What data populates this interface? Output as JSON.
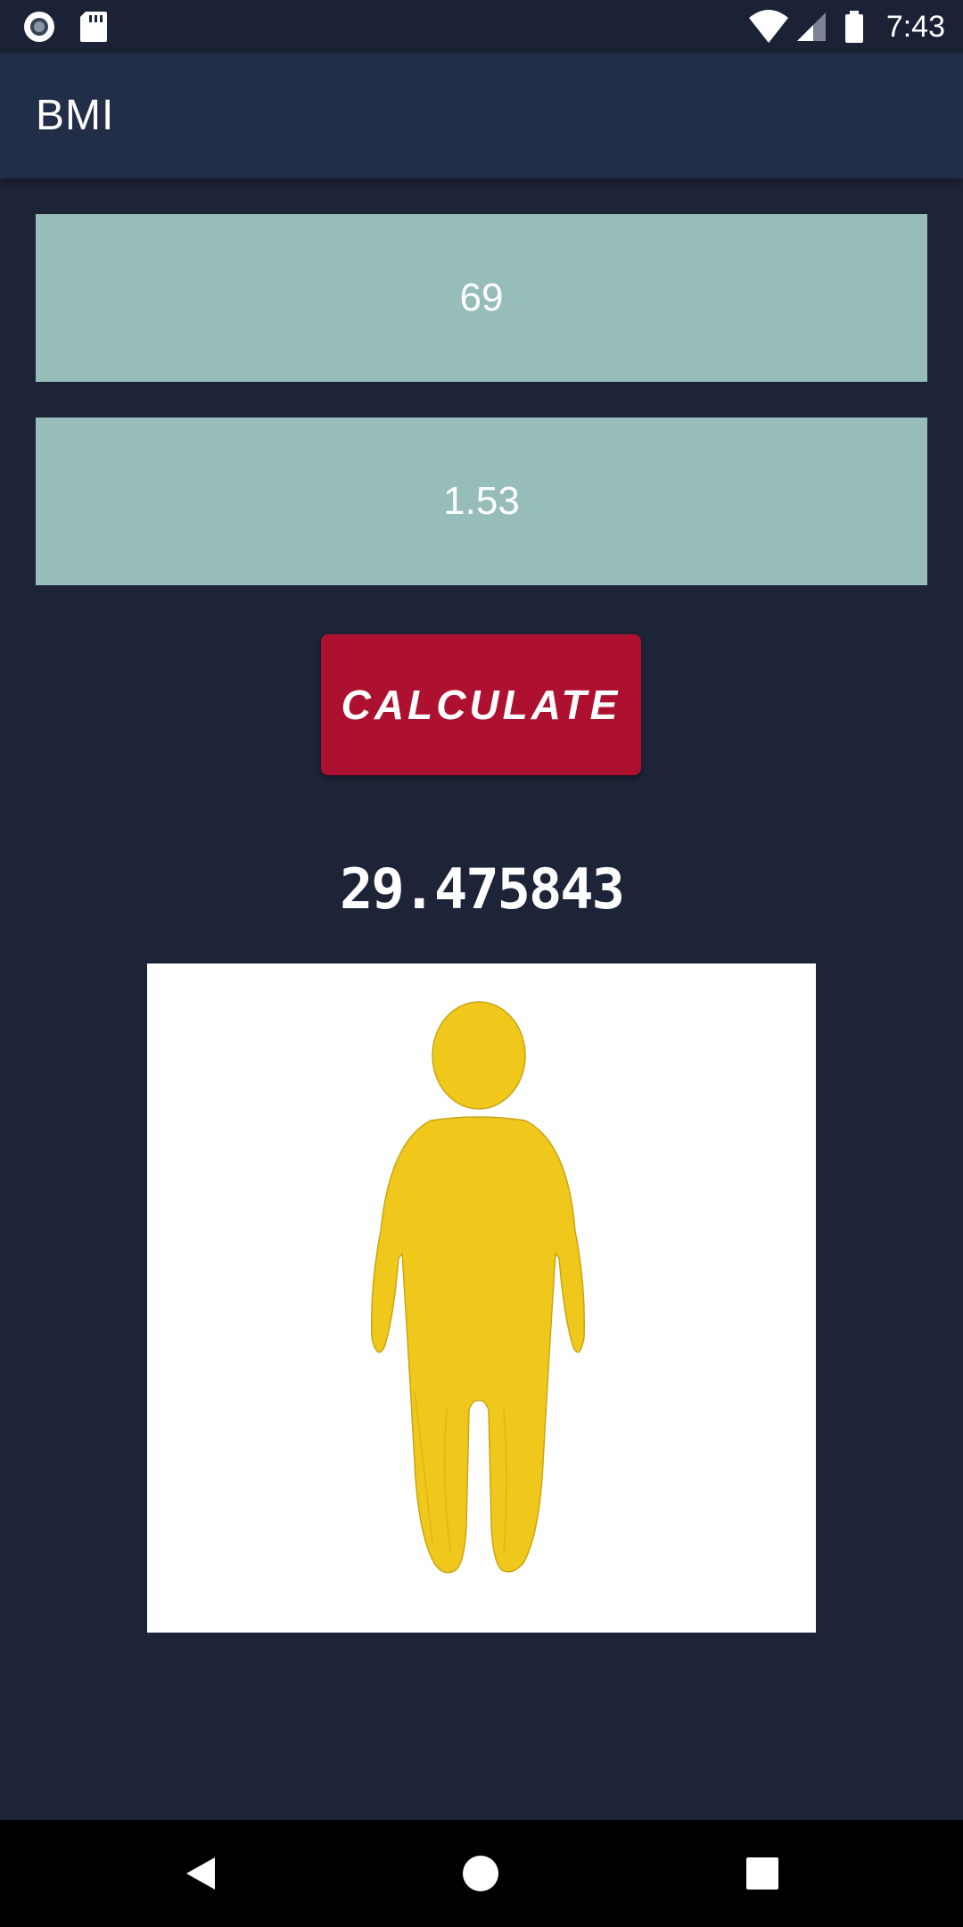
{
  "status_bar": {
    "clock": "7:43",
    "icons": [
      "record-icon",
      "sd-card-icon",
      "wifi-icon",
      "cell-signal-icon",
      "battery-icon"
    ]
  },
  "app_bar": {
    "title": "BMI"
  },
  "form": {
    "weight_value": "69",
    "height_value": "1.53",
    "calculate_label": "CALCULATE"
  },
  "result": {
    "bmi_value": "29.475843"
  },
  "illustration": {
    "icon": "overweight-person-figure",
    "figure_color": "#f0c81c"
  },
  "nav_bar": {
    "icons": [
      "back-icon",
      "home-icon",
      "recents-icon"
    ]
  },
  "colors": {
    "background": "#1d2438",
    "app_bar": "#222e48",
    "input_fill": "#97bdbb",
    "button": "#ae1130"
  }
}
